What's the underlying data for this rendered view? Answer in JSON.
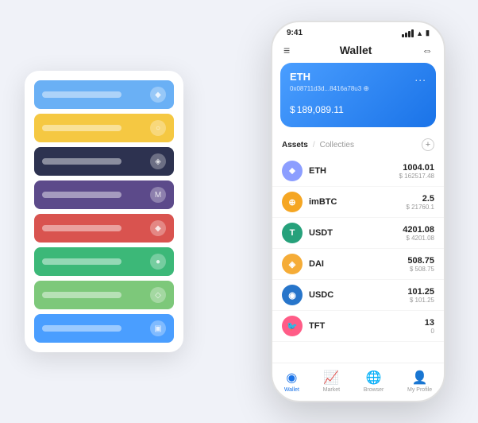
{
  "scene": {
    "background": "#f0f2f8"
  },
  "card_stack": {
    "cards": [
      {
        "color": "#6ab0f5",
        "label": "",
        "icon": "◆"
      },
      {
        "color": "#f5c842",
        "label": "",
        "icon": "○"
      },
      {
        "color": "#2d3250",
        "label": "",
        "icon": "◈"
      },
      {
        "color": "#5c4a8a",
        "label": "",
        "icon": "M"
      },
      {
        "color": "#d9534f",
        "label": "",
        "icon": "◆"
      },
      {
        "color": "#3cb878",
        "label": "",
        "icon": "●"
      },
      {
        "color": "#7dc87a",
        "label": "",
        "icon": "◇"
      },
      {
        "color": "#4a9eff",
        "label": "",
        "icon": "▣"
      }
    ]
  },
  "phone": {
    "status_bar": {
      "time": "9:41",
      "signal": "▋▋▋",
      "wifi": "WiFi",
      "battery": "🔋"
    },
    "header": {
      "menu_icon": "≡",
      "title": "Wallet",
      "expand_icon": "⇔"
    },
    "wallet_card": {
      "coin": "ETH",
      "address": "0x08711d3d...8416a78u3",
      "address_suffix": "⋮",
      "balance_currency": "$",
      "balance": "189,089.11",
      "dots": "..."
    },
    "assets": {
      "tab_active": "Assets",
      "tab_divider": "/",
      "tab_inactive": "Collecties",
      "add_icon": "+"
    },
    "asset_list": [
      {
        "icon": "⬥",
        "icon_bg": "#8c9eff",
        "name": "ETH",
        "amount": "1004.01",
        "usd": "$ 162517.48"
      },
      {
        "icon": "⊕",
        "icon_bg": "#f5a623",
        "name": "imBTC",
        "amount": "2.5",
        "usd": "$ 21760.1"
      },
      {
        "icon": "T",
        "icon_bg": "#26a17b",
        "name": "USDT",
        "amount": "4201.08",
        "usd": "$ 4201.08"
      },
      {
        "icon": "◈",
        "icon_bg": "#f5ac37",
        "name": "DAI",
        "amount": "508.75",
        "usd": "$ 508.75"
      },
      {
        "icon": "◉",
        "icon_bg": "#2775ca",
        "name": "USDC",
        "amount": "101.25",
        "usd": "$ 101.25"
      },
      {
        "icon": "🐦",
        "icon_bg": "#ff5c87",
        "name": "TFT",
        "amount": "13",
        "usd": "0"
      }
    ],
    "bottom_nav": [
      {
        "icon": "◉",
        "label": "Wallet",
        "active": true
      },
      {
        "icon": "📈",
        "label": "Market",
        "active": false
      },
      {
        "icon": "🌐",
        "label": "Browser",
        "active": false
      },
      {
        "icon": "👤",
        "label": "My Profile",
        "active": false
      }
    ]
  }
}
